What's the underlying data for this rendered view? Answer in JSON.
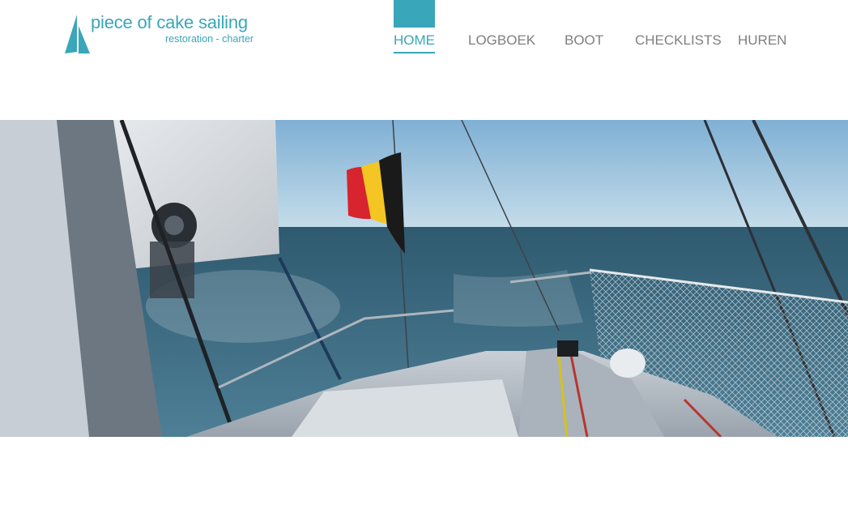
{
  "logo": {
    "title": "piece of cake sailing",
    "subtitle": "restoration - charter",
    "icon": "sail-icon"
  },
  "nav": {
    "items": [
      {
        "label": "HOME",
        "active": true
      },
      {
        "label": "LOGBOEK",
        "active": false
      },
      {
        "label": "BOOT",
        "active": false
      },
      {
        "label": "CHECKLISTS",
        "active": false
      },
      {
        "label": "HUREN",
        "active": false
      }
    ]
  },
  "hero": {
    "icon": "sailboat-photo"
  },
  "colors": {
    "accent": "#3aa6b9",
    "nav_text": "#7f7f7f",
    "sky": "#9cc3dc",
    "sea": "#3c6b82",
    "deck": "#b9c1ca"
  }
}
